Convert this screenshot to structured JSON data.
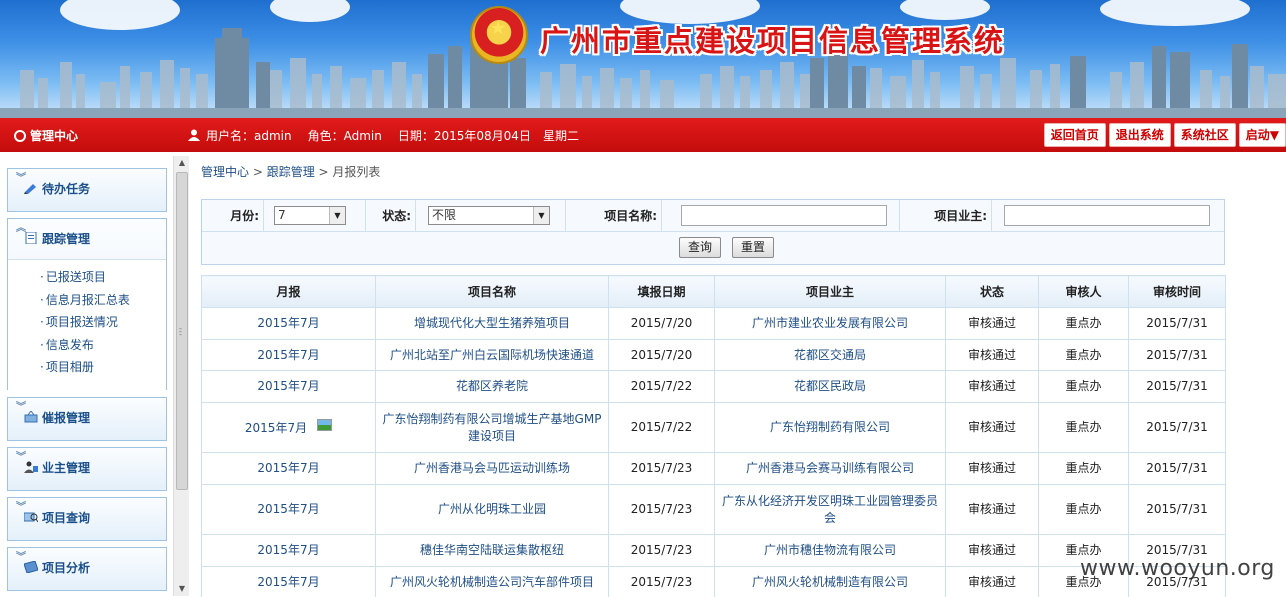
{
  "header": {
    "site_title": "广州市重点建设项目信息管理系统",
    "admin_center": "管理中心",
    "username_label": "用户名：admin",
    "role_label": "角色：Admin",
    "date_label": "日期：2015年08月04日",
    "weekday_label": "星期二",
    "buttons": [
      {
        "label": "返回首页"
      },
      {
        "label": "退出系统"
      },
      {
        "label": "系统社区"
      },
      {
        "label": "启动▼"
      }
    ]
  },
  "sidebar": {
    "menus": [
      {
        "label": "待办任务",
        "icon": "pencil-icon"
      },
      {
        "label": "跟踪管理",
        "icon": "document-icon",
        "items": [
          "已报送项目",
          "信息月报汇总表",
          "项目报送情况",
          "信息发布",
          "项目相册"
        ]
      },
      {
        "label": "催报管理",
        "icon": "reminder-icon"
      },
      {
        "label": "业主管理",
        "icon": "owner-icon"
      },
      {
        "label": "项目查询",
        "icon": "query-icon"
      },
      {
        "label": "项目分析",
        "icon": "analysis-icon"
      }
    ]
  },
  "breadcrumb": {
    "part1": "管理中心",
    "sep": " > ",
    "part2": "跟踪管理",
    "part3": "月报列表"
  },
  "filters": {
    "month_label": "月份:",
    "month_value": "7",
    "status_label": "状态:",
    "status_value": "不限",
    "project_name_label": "项目名称:",
    "project_name_value": "",
    "project_owner_label": "项目业主:",
    "project_owner_value": "",
    "query_button": "查询",
    "reset_button": "重置"
  },
  "table": {
    "columns": [
      "月报",
      "项目名称",
      "填报日期",
      "项目业主",
      "状态",
      "审核人",
      "审核时间"
    ],
    "rows": [
      {
        "month": "2015年7月",
        "name": "增城现代化大型生猪养殖项目",
        "date": "2015/7/20",
        "owner": "广州市建业农业发展有限公司",
        "status": "审核通过",
        "reviewer": "重点办",
        "review_time": "2015/7/31"
      },
      {
        "month": "2015年7月",
        "name": "广州北站至广州白云国际机场快速通道",
        "date": "2015/7/20",
        "owner": "花都区交通局",
        "status": "审核通过",
        "reviewer": "重点办",
        "review_time": "2015/7/31"
      },
      {
        "month": "2015年7月",
        "name": "花都区养老院",
        "date": "2015/7/22",
        "owner": "花都区民政局",
        "status": "审核通过",
        "reviewer": "重点办",
        "review_time": "2015/7/31"
      },
      {
        "month": "2015年7月",
        "name": "广东怡翔制药有限公司增城生产基地GMP建设项目",
        "date": "2015/7/22",
        "owner": "广东怡翔制药有限公司",
        "status": "审核通过",
        "reviewer": "重点办",
        "review_time": "2015/7/31",
        "has_image": true
      },
      {
        "month": "2015年7月",
        "name": "广州香港马会马匹运动训练场",
        "date": "2015/7/23",
        "owner": "广州香港马会赛马训练有限公司",
        "status": "审核通过",
        "reviewer": "重点办",
        "review_time": "2015/7/31"
      },
      {
        "month": "2015年7月",
        "name": "广州从化明珠工业园",
        "date": "2015/7/23",
        "owner": "广东从化经济开发区明珠工业园管理委员会",
        "status": "审核通过",
        "reviewer": "重点办",
        "review_time": "2015/7/31"
      },
      {
        "month": "2015年7月",
        "name": "穗佳华南空陆联运集散枢纽",
        "date": "2015/7/23",
        "owner": "广州市穗佳物流有限公司",
        "status": "审核通过",
        "reviewer": "重点办",
        "review_time": "2015/7/31"
      },
      {
        "month": "2015年7月",
        "name": "广州风火轮机械制造公司汽车部件项目",
        "date": "2015/7/23",
        "owner": "广州风火轮机械制造有限公司",
        "status": "审核通过",
        "reviewer": "重点办",
        "review_time": "2015/7/31"
      }
    ]
  },
  "watermark": "www.wooyun.org",
  "colors": {
    "banner_sky": "#3d8fe6",
    "title_red": "#d81414",
    "bar_red": "#d81414",
    "link_blue": "#1f4f85",
    "border_blue": "#cfe0ef"
  }
}
